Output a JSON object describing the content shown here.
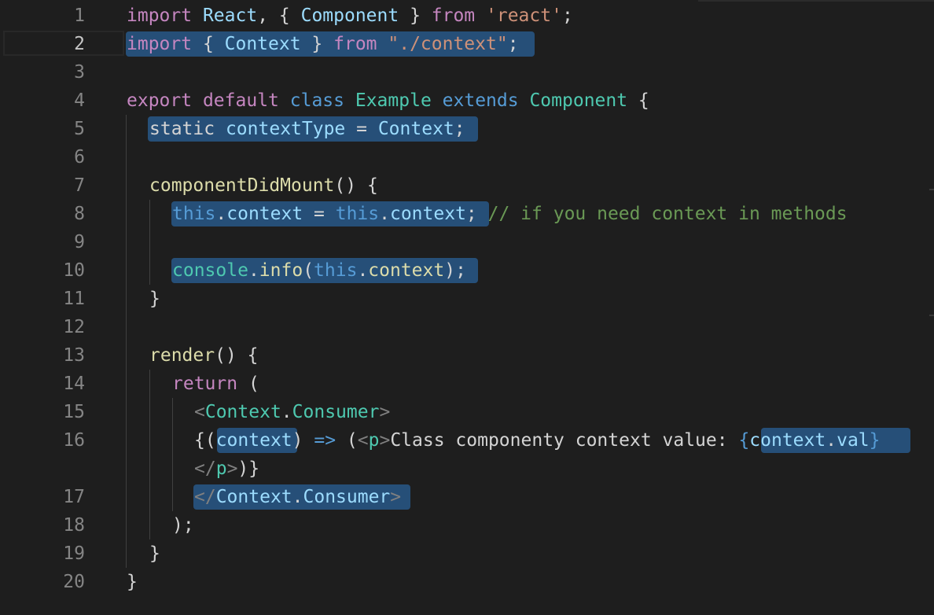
{
  "editor": {
    "line_numbers": [
      "1",
      "2",
      "3",
      "4",
      "5",
      "6",
      "7",
      "8",
      "9",
      "10",
      "11",
      "12",
      "13",
      "14",
      "15",
      "16",
      "",
      "17",
      "18",
      "19",
      "20"
    ],
    "active_line": "2"
  },
  "code": {
    "l1": {
      "t1": "import",
      "t2": " ",
      "t3": "React",
      "t4": ", { ",
      "t5": "Component",
      "t6": " } ",
      "t7": "from",
      "t8": " ",
      "t9": "'react'",
      "t10": ";"
    },
    "l2": {
      "t1": "import",
      "t2": " { ",
      "t3": "Context",
      "t4": " } ",
      "t5": "from",
      "t6": " ",
      "t7": "\"./context\"",
      "t8": ";"
    },
    "l4": {
      "t1": "export",
      "t2": " ",
      "t3": "default",
      "t4": " ",
      "t5": "class",
      "t6": " ",
      "t7": "Example",
      "t8": " ",
      "t9": "extends",
      "t10": " ",
      "t11": "Component",
      "t12": " {"
    },
    "l5": {
      "t1": "static",
      "t2": " ",
      "t3": "contextType",
      "t4": " = ",
      "t5": "Context",
      "t6": ";"
    },
    "l7": {
      "t1": "componentDidMount",
      "t2": "() {"
    },
    "l8": {
      "t1": "this",
      "t2": ".",
      "t3": "context",
      "t4": " = ",
      "t5": "this",
      "t6": ".",
      "t7": "context",
      "t8": ";",
      "t9": " ",
      "t10": "// if you need context in methods"
    },
    "l10": {
      "t1": "console",
      "t2": ".",
      "t3": "info",
      "t4": "(",
      "t5": "this",
      "t6": ".",
      "t7": "context",
      "t8": ");"
    },
    "l11": {
      "t1": "}"
    },
    "l13": {
      "t1": "render",
      "t2": "() {"
    },
    "l14": {
      "t1": "return",
      "t2": " ("
    },
    "l15": {
      "t1": "<",
      "t2": "Context",
      "t3": ".",
      "t4": "Consumer",
      "t5": ">"
    },
    "l16": {
      "t1": "{(",
      "t2": "context",
      "t3": ") ",
      "t4": "=>",
      "t5": " (",
      "t6": "<",
      "t7": "p",
      "t8": ">",
      "t9": "Class componenty context value: ",
      "t10": "{",
      "t11": "context",
      "t12": ".",
      "t13": "val",
      "t14": "}"
    },
    "l16b": {
      "t1": "</",
      "t2": "p",
      "t3": ">",
      "t4": ")}"
    },
    "l17": {
      "t1": "</",
      "t2": "Context",
      "t3": ".",
      "t4": "Consumer",
      "t5": ">"
    },
    "l18": {
      "t1": ");"
    },
    "l19": {
      "t1": "}"
    },
    "l20": {
      "t1": "}"
    }
  },
  "colors": {
    "background": "#1e1e1e",
    "keyword": "#c586c0",
    "storage": "#569cd6",
    "variable": "#9cdcfe",
    "type": "#4ec9b0",
    "function": "#dcdcaa",
    "string": "#ce9178",
    "comment": "#6a9955",
    "selection": "#264f78",
    "line_number": "#858585"
  }
}
